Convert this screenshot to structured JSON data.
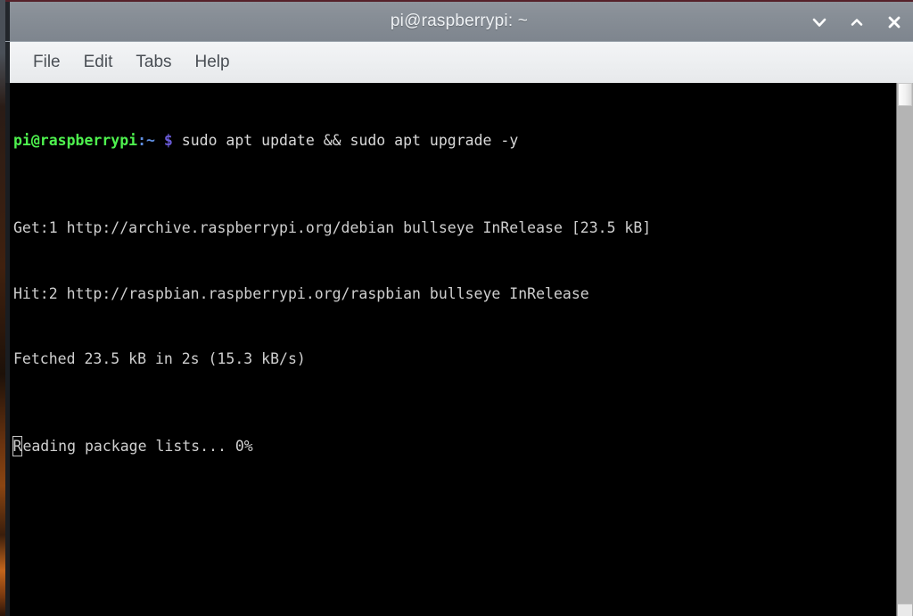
{
  "window": {
    "title": "pi@raspberrypi: ~",
    "controls": [
      {
        "name": "minimize",
        "label": "⌄"
      },
      {
        "name": "maximize",
        "label": "⌃"
      },
      {
        "name": "close",
        "label": "✕"
      }
    ]
  },
  "menubar": {
    "items": [
      {
        "label": "File"
      },
      {
        "label": "Edit"
      },
      {
        "label": "Tabs"
      },
      {
        "label": "Help"
      }
    ]
  },
  "terminal": {
    "prompt": {
      "user_host": "pi@raspberrypi",
      "path": ":~",
      "symbol": "$"
    },
    "command": " sudo apt update && sudo apt upgrade -y",
    "output_lines": [
      "Get:1 http://archive.raspberrypi.org/debian bullseye InRelease [23.5 kB]",
      "Hit:2 http://raspbian.raspberrypi.org/raspbian bullseye InRelease",
      "Fetched 23.5 kB in 2s (15.3 kB/s)"
    ],
    "status_line": {
      "cursor_char": "R",
      "rest": "eading package lists... 0%"
    }
  },
  "colors": {
    "prompt_user": "#4ef24e",
    "prompt_path": "#5f8ee0",
    "prompt_symbol": "#6a5bd8",
    "terminal_bg": "#000000",
    "terminal_fg": "#d4d4d4",
    "titlebar_bg": "#868d95",
    "menubar_bg": "#eceef0"
  }
}
